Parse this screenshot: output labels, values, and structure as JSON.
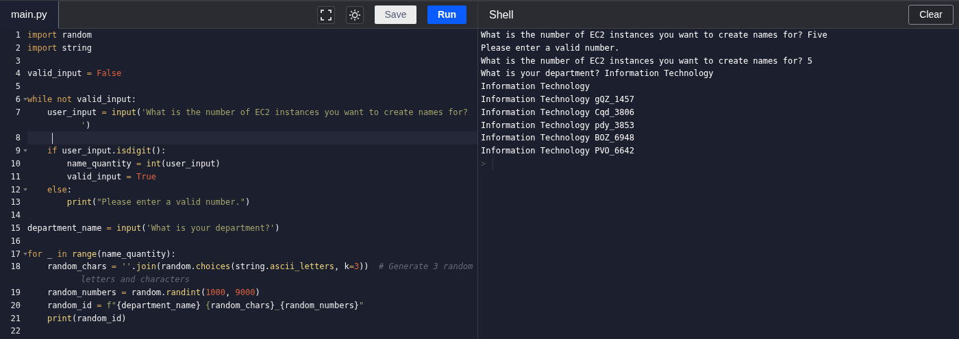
{
  "editor": {
    "tabs": [
      {
        "label": "main.py",
        "selected": true
      }
    ],
    "toolbar": {
      "save": "Save",
      "run": "Run"
    },
    "lines": [
      {
        "number": "1",
        "tokens": [
          {
            "kind": "kw",
            "text": "import"
          },
          {
            "kind": "plain",
            "text": " random"
          }
        ]
      },
      {
        "number": "2",
        "tokens": [
          {
            "kind": "kw",
            "text": "import"
          },
          {
            "kind": "plain",
            "text": " string"
          }
        ]
      },
      {
        "number": "3"
      },
      {
        "number": "4",
        "tokens": [
          {
            "kind": "plain",
            "text": "valid_input "
          },
          {
            "kind": "op",
            "text": "= "
          },
          {
            "kind": "const",
            "text": "False"
          }
        ]
      },
      {
        "number": "5"
      },
      {
        "number": "6",
        "fold": true,
        "tokens": [
          {
            "kind": "kw",
            "text": "while not"
          },
          {
            "kind": "plain",
            "text": " valid_input:"
          }
        ]
      },
      {
        "number": "7",
        "tokens": [
          {
            "kind": "plain",
            "text": "    user_input "
          },
          {
            "kind": "op",
            "text": "= "
          },
          {
            "kind": "fn",
            "text": "input"
          },
          {
            "kind": "plain",
            "text": "("
          },
          {
            "kind": "str",
            "text": "'What is the number of EC2 instances you want to create names for? '"
          },
          {
            "kind": "plain",
            "text": ")"
          }
        ]
      },
      {
        "number": "8",
        "active": true
      },
      {
        "number": "9",
        "fold": true,
        "tokens": [
          {
            "kind": "kw",
            "text": "    if"
          },
          {
            "kind": "plain",
            "text": " user_input."
          },
          {
            "kind": "fn",
            "text": "isdigit"
          },
          {
            "kind": "plain",
            "text": "():"
          }
        ]
      },
      {
        "number": "10",
        "tokens": [
          {
            "kind": "plain",
            "text": "        name_quantity "
          },
          {
            "kind": "op",
            "text": "= "
          },
          {
            "kind": "fn",
            "text": "int"
          },
          {
            "kind": "plain",
            "text": "(user_input)"
          }
        ]
      },
      {
        "number": "11",
        "tokens": [
          {
            "kind": "plain",
            "text": "        valid_input "
          },
          {
            "kind": "op",
            "text": "= "
          },
          {
            "kind": "const",
            "text": "True"
          }
        ]
      },
      {
        "number": "12",
        "fold": true,
        "tokens": [
          {
            "kind": "kw",
            "text": "    else"
          },
          {
            "kind": "plain",
            "text": ":"
          }
        ]
      },
      {
        "number": "13",
        "tokens": [
          {
            "kind": "fn",
            "text": "        print"
          },
          {
            "kind": "plain",
            "text": "("
          },
          {
            "kind": "str",
            "text": "\"Please enter a valid number.\""
          },
          {
            "kind": "plain",
            "text": ")"
          }
        ]
      },
      {
        "number": "14"
      },
      {
        "number": "15",
        "tokens": [
          {
            "kind": "plain",
            "text": "department_name "
          },
          {
            "kind": "op",
            "text": "= "
          },
          {
            "kind": "fn",
            "text": "input"
          },
          {
            "kind": "plain",
            "text": "("
          },
          {
            "kind": "str",
            "text": "'What is your department?'"
          },
          {
            "kind": "plain",
            "text": ")"
          }
        ]
      },
      {
        "number": "16"
      },
      {
        "number": "17",
        "fold": true,
        "tokens": [
          {
            "kind": "kw",
            "text": "for"
          },
          {
            "kind": "plain",
            "text": " _ "
          },
          {
            "kind": "kw",
            "text": "in "
          },
          {
            "kind": "fn",
            "text": "range"
          },
          {
            "kind": "plain",
            "text": "(name_quantity):"
          }
        ]
      },
      {
        "number": "18",
        "tokens": [
          {
            "kind": "plain",
            "text": "    random_chars "
          },
          {
            "kind": "op",
            "text": "= "
          },
          {
            "kind": "str",
            "text": "''"
          },
          {
            "kind": "plain",
            "text": "."
          },
          {
            "kind": "fn",
            "text": "join"
          },
          {
            "kind": "plain",
            "text": "(random."
          },
          {
            "kind": "fn",
            "text": "choices"
          },
          {
            "kind": "plain",
            "text": "(string."
          },
          {
            "kind": "fn",
            "text": "ascii_letters"
          },
          {
            "kind": "plain",
            "text": ", k"
          },
          {
            "kind": "op",
            "text": "="
          },
          {
            "kind": "num",
            "text": "3"
          },
          {
            "kind": "plain",
            "text": "))  "
          },
          {
            "kind": "cmt",
            "text": "# Generate 3 random letters and characters"
          }
        ]
      },
      {
        "number": "19",
        "tokens": [
          {
            "kind": "plain",
            "text": "    random_numbers "
          },
          {
            "kind": "op",
            "text": "="
          },
          {
            "kind": "plain",
            "text": " random."
          },
          {
            "kind": "fn",
            "text": "randint"
          },
          {
            "kind": "plain",
            "text": "("
          },
          {
            "kind": "num",
            "text": "1000"
          },
          {
            "kind": "plain",
            "text": ", "
          },
          {
            "kind": "num",
            "text": "9000"
          },
          {
            "kind": "plain",
            "text": ")"
          }
        ]
      },
      {
        "number": "20",
        "tokens": [
          {
            "kind": "plain",
            "text": "    random_id "
          },
          {
            "kind": "op",
            "text": "= "
          },
          {
            "kind": "str",
            "text": "f\""
          },
          {
            "kind": "plain",
            "text": "{department_name}"
          },
          {
            "kind": "str",
            "text": " {"
          },
          {
            "kind": "plain",
            "text": "random_chars}"
          },
          {
            "kind": "str",
            "text": "_"
          },
          {
            "kind": "plain",
            "text": "{random_numbers}"
          },
          {
            "kind": "str",
            "text": "\""
          }
        ]
      },
      {
        "number": "21",
        "tokens": [
          {
            "kind": "fn",
            "text": "    print"
          },
          {
            "kind": "plain",
            "text": "(random_id)"
          }
        ]
      },
      {
        "number": "22"
      }
    ]
  },
  "shell": {
    "title": "Shell",
    "clear": "Clear",
    "output": [
      "What is the number of EC2 instances you want to create names for? Five",
      "Please enter a valid number.",
      "What is the number of EC2 instances you want to create names for? 5",
      "What is your department? Information Technology",
      "Information Technology",
      "Information Technology gQZ_1457",
      "Information Technology Cqd_3806",
      "Information Technology pdy_3853",
      "Information Technology BOZ_6948",
      "Information Technology PVO_6642"
    ],
    "prompt": ">"
  }
}
